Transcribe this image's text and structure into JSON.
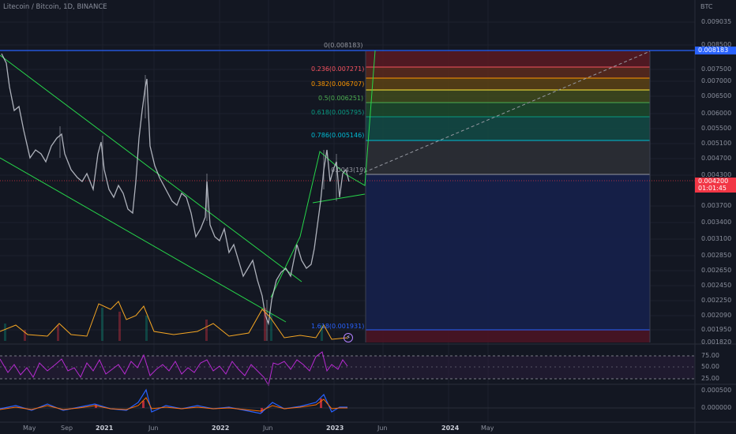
{
  "header": {
    "symbol_title": "Litecoin / Bitcoin, 1D, BINANCE",
    "currency_unit": "BTC"
  },
  "price_axis": {
    "ticks": [
      "0.009035",
      "0.008500",
      "0.007500",
      "0.007000",
      "0.006500",
      "0.006000",
      "0.005500",
      "0.005100",
      "0.004700",
      "0.004300",
      "0.003700",
      "0.003400",
      "0.003100",
      "0.002850",
      "0.002650",
      "0.002450",
      "0.002250",
      "0.002090",
      "0.001950",
      "0.001820"
    ]
  },
  "price_tags": {
    "high": "0.008183",
    "last": "0.004200",
    "countdown": "01:01:45"
  },
  "fib_levels": [
    {
      "label": "0(0.008183)",
      "color": "#9598a1"
    },
    {
      "label": "0.236(0.007271)",
      "color": "#f7525f"
    },
    {
      "label": "0.382(0.006707)",
      "color": "#ff9800"
    },
    {
      "label": "0.5(0.006251)",
      "color": "#4caf50"
    },
    {
      "label": "0.618(0.005795)",
      "color": "#089981"
    },
    {
      "label": "0.786(0.005146)",
      "color": "#00bcd4"
    },
    {
      "label": "0.0043(19)",
      "color": "#9598a1"
    },
    {
      "label": "1.618(0.001931)",
      "color": "#2962ff"
    }
  ],
  "rsi_axis": {
    "ticks": [
      "75.00",
      "50.00",
      "25.00"
    ]
  },
  "macd_axis": {
    "ticks": [
      "0.000500",
      "0.000000"
    ]
  },
  "time_axis": {
    "ticks": [
      "May",
      "Sep",
      "2021",
      "Jun",
      "2022",
      "Jun",
      "2023",
      "Jun",
      "2024",
      "May"
    ]
  },
  "indicators": {
    "flash_icon": "⚡"
  },
  "colors": {
    "background": "#131722",
    "high_line": "#2962ff",
    "last_price": "#f23645",
    "channel": "#26d64a",
    "rsi": "#b72bd1"
  }
}
